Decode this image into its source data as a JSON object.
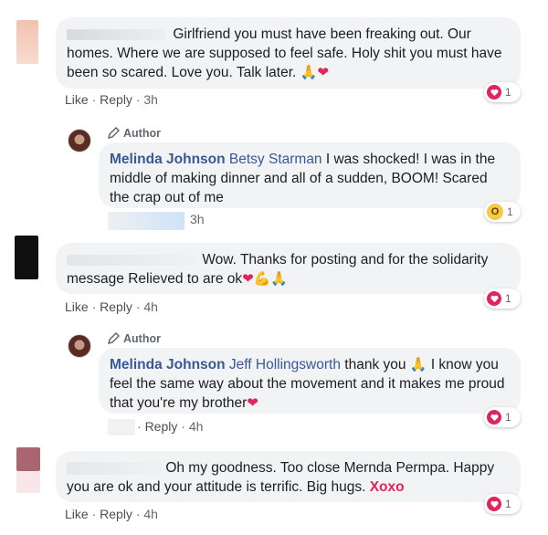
{
  "comments": [
    {
      "text": "Girlfriend you must have been freaking out. Our homes. Where we are supposed to feel safe. Holy shit you must have been so scared. Love you. Talk later.",
      "emoji_trail": [
        "pray-emoji",
        "heart-emoji"
      ],
      "like": "Like",
      "reply": "Reply",
      "time": "3h",
      "reaction_count": "1",
      "reaction": "love"
    },
    {
      "author_badge": "Author",
      "name": "Melinda Johnson",
      "tag": "Betsy Starman",
      "text": "I was shocked! I was in the middle of making dinner and all of a sudden, BOOM! Scared the crap out of me",
      "time": "3h",
      "reaction_count": "1",
      "reaction": "wow"
    },
    {
      "text": "Wow. Thanks for posting and for the solidarity message Relieved to are ok",
      "emoji_trail": [
        "heart-emoji",
        "muscle-emoji",
        "pray-emoji"
      ],
      "like": "Like",
      "reply": "Reply",
      "time": "4h",
      "reaction_count": "1",
      "reaction": "love"
    },
    {
      "author_badge": "Author",
      "name": "Melinda Johnson",
      "tag": "Jeff Hollingsworth",
      "text_a": "thank you",
      "text_b": "I know you feel the same way about the movement and it makes me proud that you're my brother",
      "reply": "Reply",
      "time": "4h",
      "reaction_count": "1",
      "reaction": "love"
    },
    {
      "text": "Oh my goodness. Too close Mernda Permpa. Happy you are ok and your attitude is terrific. Big hugs.",
      "highlight": "Xoxo",
      "like": "Like",
      "reply": "Reply",
      "time": "4h",
      "reaction_count": "1",
      "reaction": "love"
    }
  ],
  "colors": {
    "bubble": "#f2f3f5",
    "link": "#385898",
    "love": "#e0245e",
    "wow": "#f7c944"
  }
}
